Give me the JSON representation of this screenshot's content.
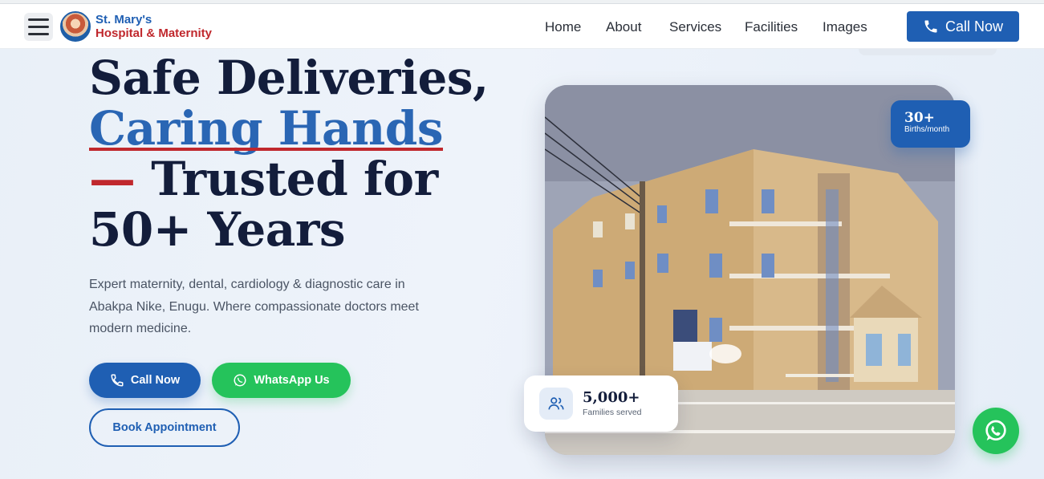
{
  "header": {
    "brand_line1": "St. Mary's",
    "brand_line2": "Hospital & Maternity",
    "nav": [
      "Home",
      "About",
      "Services",
      "Facilities",
      "Images"
    ],
    "call_now": "Call Now"
  },
  "hero": {
    "headline": {
      "line1": "Safe Deliveries,",
      "highlight": "Caring Hands",
      "dash": "—",
      "line3": " Trusted for",
      "line4": "50+ Years"
    },
    "subtext": "Expert maternity, dental, cardiology & diagnostic care in Abakpa Nike, Enugu. Where compassionate doctors meet modern medicine.",
    "buttons": {
      "call": "Call Now",
      "whatsapp": "WhatsApp Us",
      "book": "Book Appointment"
    }
  },
  "stats": {
    "births_value": "30+",
    "births_label": "Births/month",
    "families_value": "5,000+",
    "families_label": "Families served"
  },
  "colors": {
    "primary": "#1f5fb3",
    "accent_red": "#c0282d",
    "whatsapp_green": "#25c35b",
    "headline": "#131d3b"
  },
  "icons": {
    "menu": "hamburger-icon",
    "phone": "phone-icon",
    "whatsapp": "whatsapp-icon",
    "users": "users-icon"
  }
}
